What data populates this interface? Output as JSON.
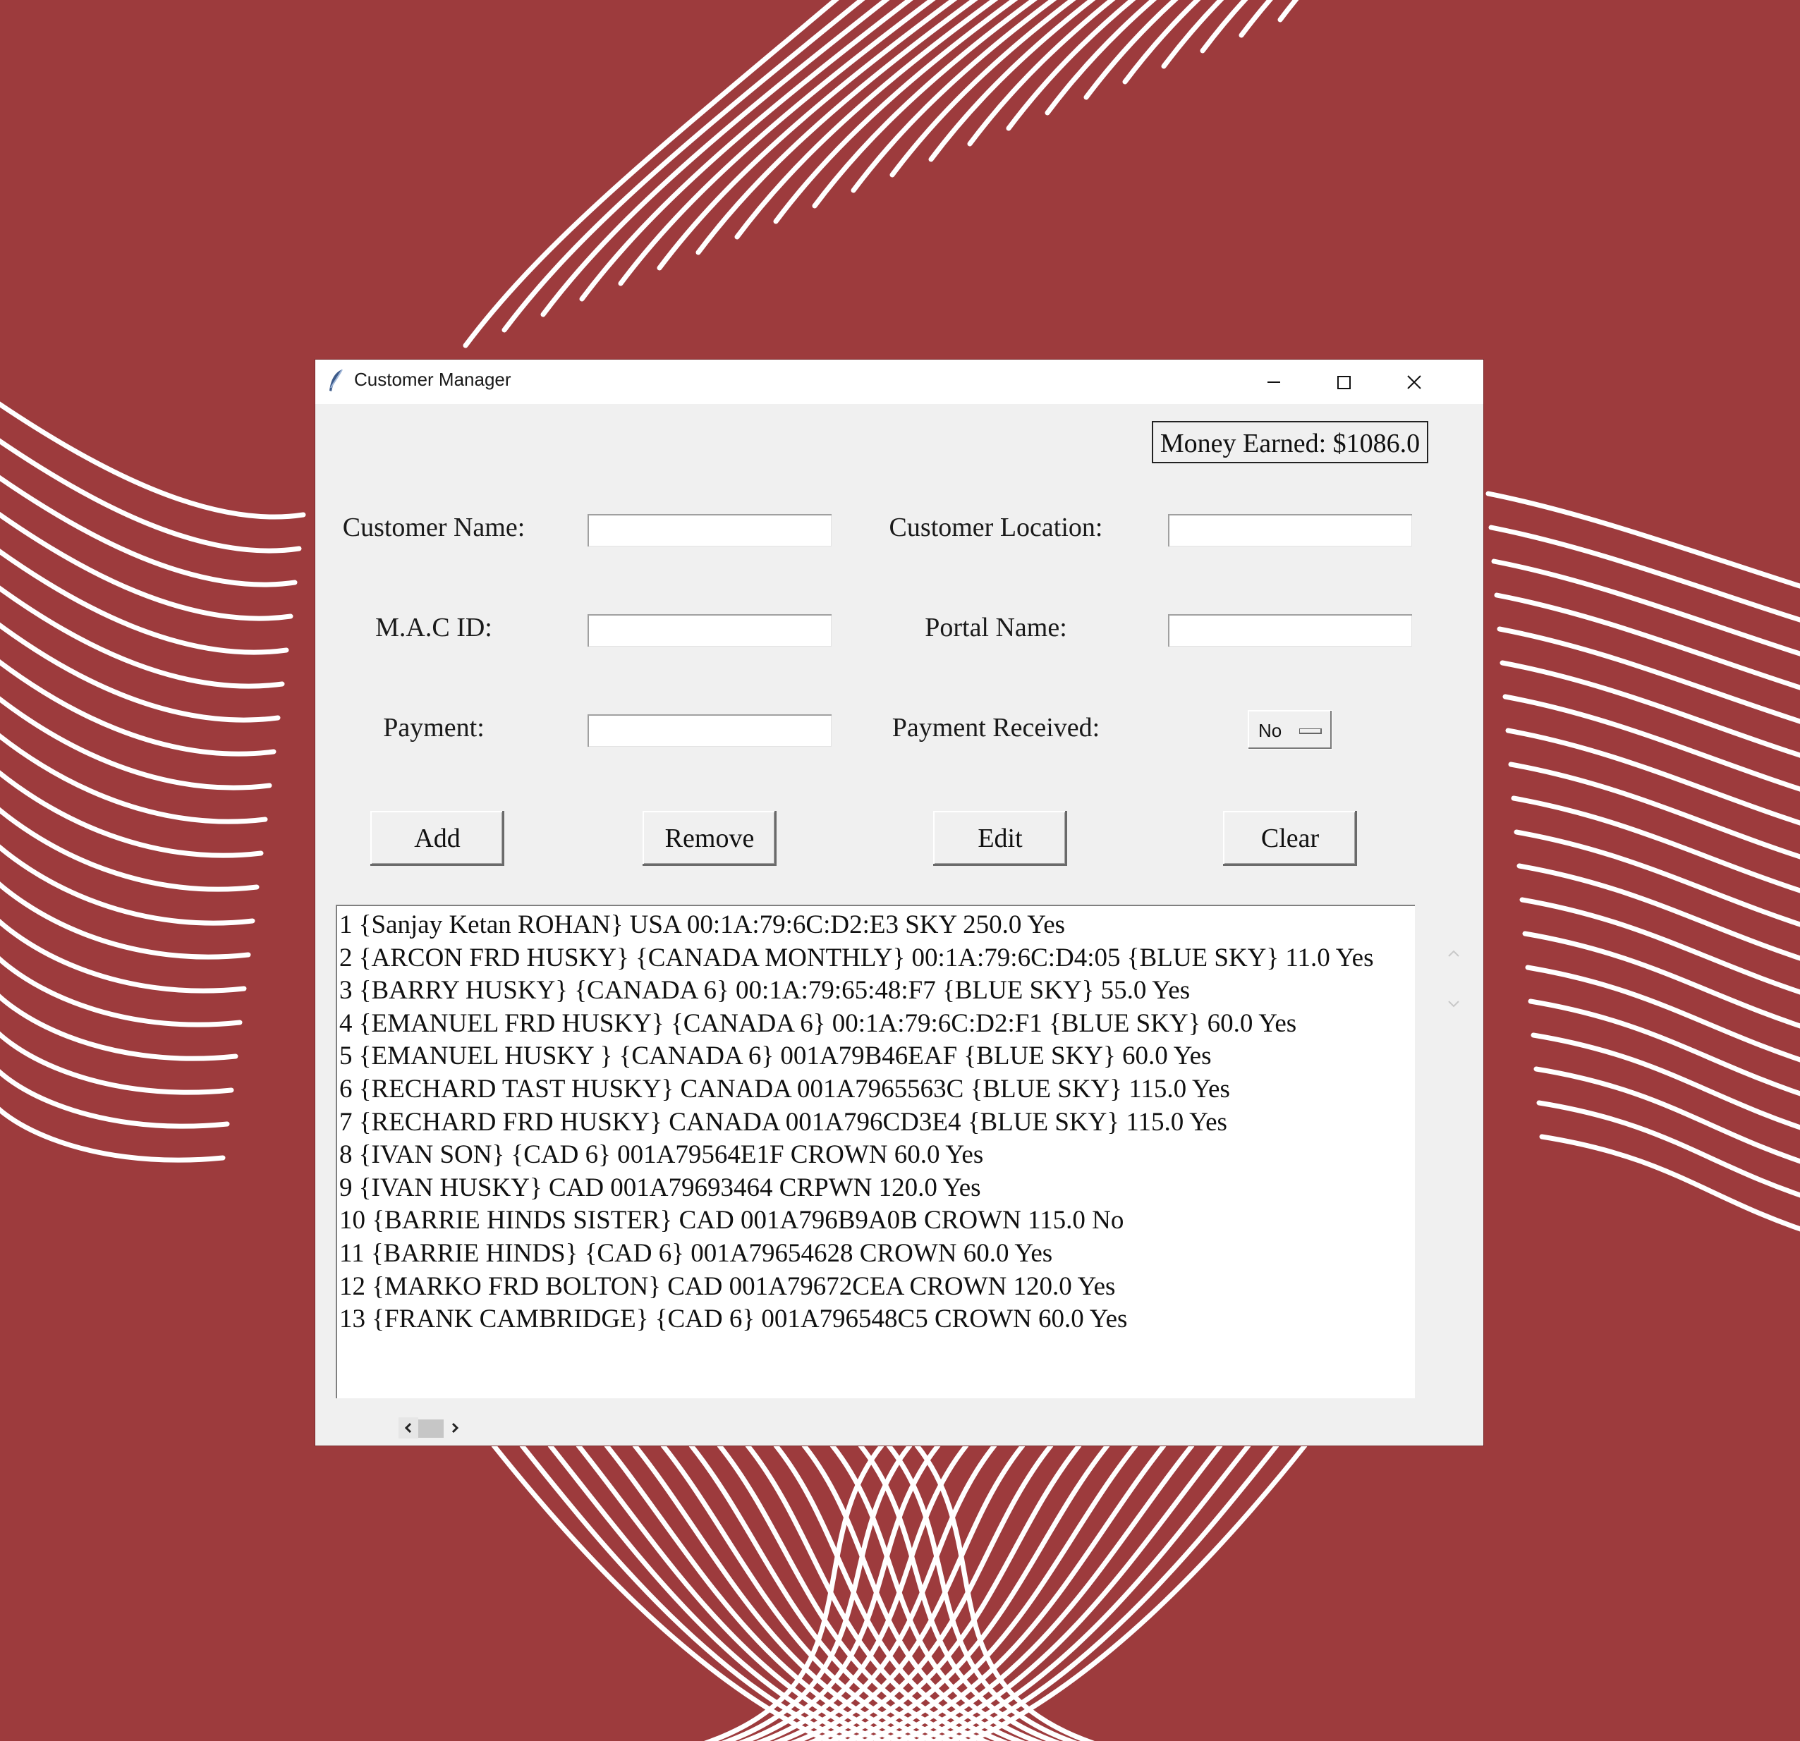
{
  "window": {
    "title": "Customer Manager"
  },
  "money_earned": "Money Earned: $1086.0",
  "form": {
    "customer_name_label": "Customer Name:",
    "customer_location_label": "Customer Location:",
    "mac_id_label": "M.A.C ID:",
    "portal_name_label": "Portal Name:",
    "payment_label": "Payment:",
    "payment_received_label": "Payment Received:",
    "payment_received_value": "No",
    "customer_name_value": "",
    "customer_location_value": "",
    "mac_id_value": "",
    "portal_name_value": "",
    "payment_value": ""
  },
  "buttons": {
    "add": "Add",
    "remove": "Remove",
    "edit": "Edit",
    "clear": "Clear"
  },
  "customers": [
    "1 {Sanjay Ketan ROHAN} USA 00:1A:79:6C:D2:E3 SKY 250.0 Yes",
    "2 {ARCON FRD HUSKY} {CANADA MONTHLY} 00:1A:79:6C:D4:05 {BLUE SKY} 11.0 Yes",
    "3 {BARRY HUSKY} {CANADA 6} 00:1A:79:65:48:F7 {BLUE SKY} 55.0 Yes",
    "4 {EMANUEL FRD HUSKY} {CANADA 6} 00:1A:79:6C:D2:F1 {BLUE SKY} 60.0 Yes",
    "5 {EMANUEL HUSKY } {CANADA 6} 001A79B46EAF {BLUE SKY} 60.0 Yes",
    "6 {RECHARD TAST HUSKY} CANADA 001A7965563C {BLUE SKY} 115.0 Yes",
    "7 {RECHARD FRD HUSKY} CANADA 001A796CD3E4 {BLUE SKY} 115.0 Yes",
    "8 {IVAN SON} {CAD 6} 001A79564E1F CROWN 60.0 Yes",
    "9 {IVAN HUSKY} CAD 001A79693464 CRPWN 120.0 Yes",
    "10 {BARRIE HINDS SISTER} CAD 001A796B9A0B CROWN 115.0 No",
    "11 {BARRIE HINDS} {CAD 6} 001A79654628 CROWN 60.0 Yes",
    "12 {MARKO FRD BOLTON} CAD 001A79672CEA CROWN 120.0 Yes",
    "13 {FRANK CAMBRIDGE} {CAD 6} 001A796548C5 CROWN 60.0 Yes"
  ],
  "icons": {
    "app": "feather-icon",
    "minimize": "minimize-icon",
    "maximize": "maximize-icon",
    "close": "close-icon"
  },
  "colors": {
    "background": "#9d3b3d",
    "window": "#f0f0f0",
    "titlebar": "#ffffff"
  }
}
